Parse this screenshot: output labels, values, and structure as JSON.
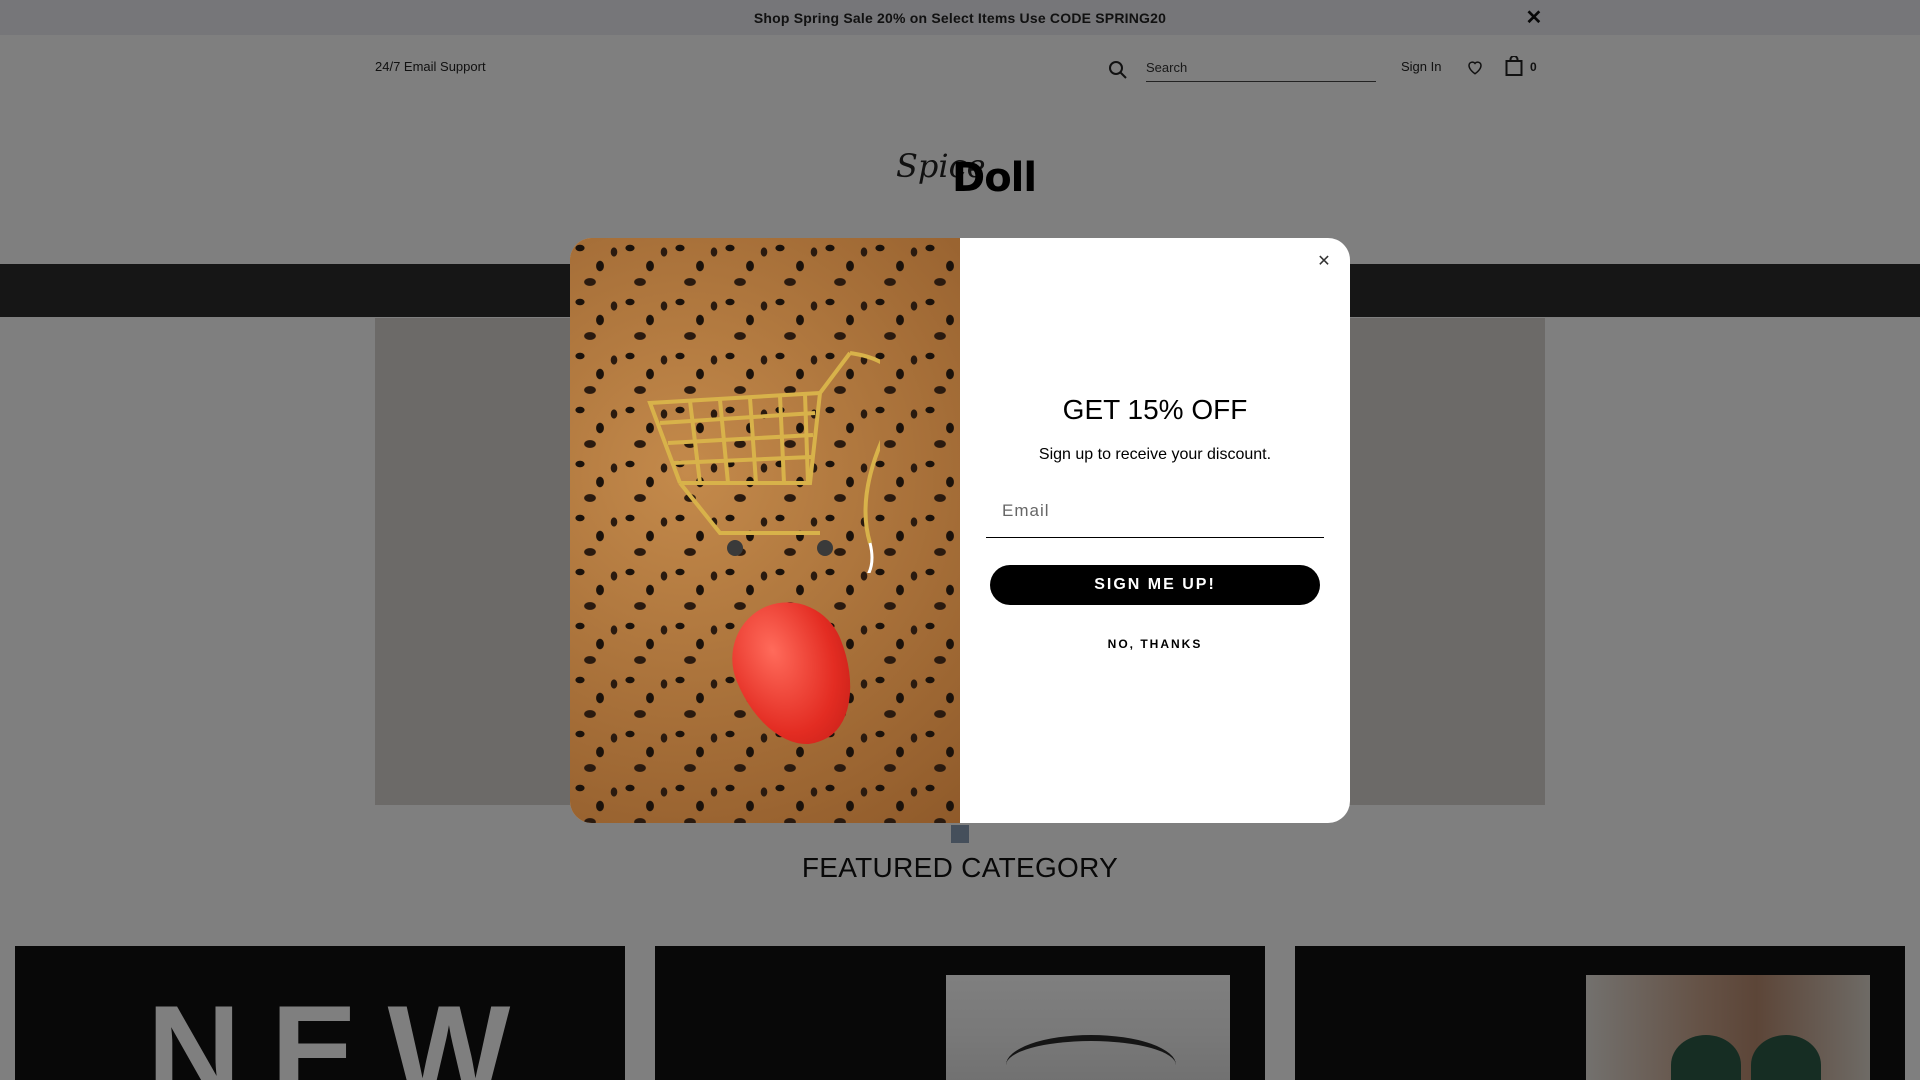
{
  "announcement": {
    "text": "Shop Spring Sale 20% on Select Items Use CODE SPRING20",
    "close_icon": "close-icon"
  },
  "header": {
    "support": "24/7 Email Support",
    "search_placeholder": "Search",
    "signin": "Sign In",
    "wishlist_icon": "heart-icon",
    "cart_icon": "shopping-bag-icon",
    "cart_count": "0"
  },
  "logo": {
    "script": "Spice",
    "bold": "Doll"
  },
  "featured": {
    "title": "FEATURED CATEGORY",
    "cards": [
      {
        "text": "NEW"
      },
      {
        "image": "eyelash-photo"
      },
      {
        "image": "model-photo"
      }
    ]
  },
  "popup": {
    "title": "GET 15% OFF",
    "subtitle": "Sign up to receive your discount.",
    "email_placeholder": "Email",
    "signup_label": "SIGN ME UP!",
    "decline_label": "NO, THANKS",
    "close_symbol": "✕",
    "image": "leopard-print-cart-and-mouse"
  },
  "colors": {
    "navbar": "#2c2c2c",
    "button": "#000000",
    "overlay": "rgba(0,0,0,0.5)"
  }
}
